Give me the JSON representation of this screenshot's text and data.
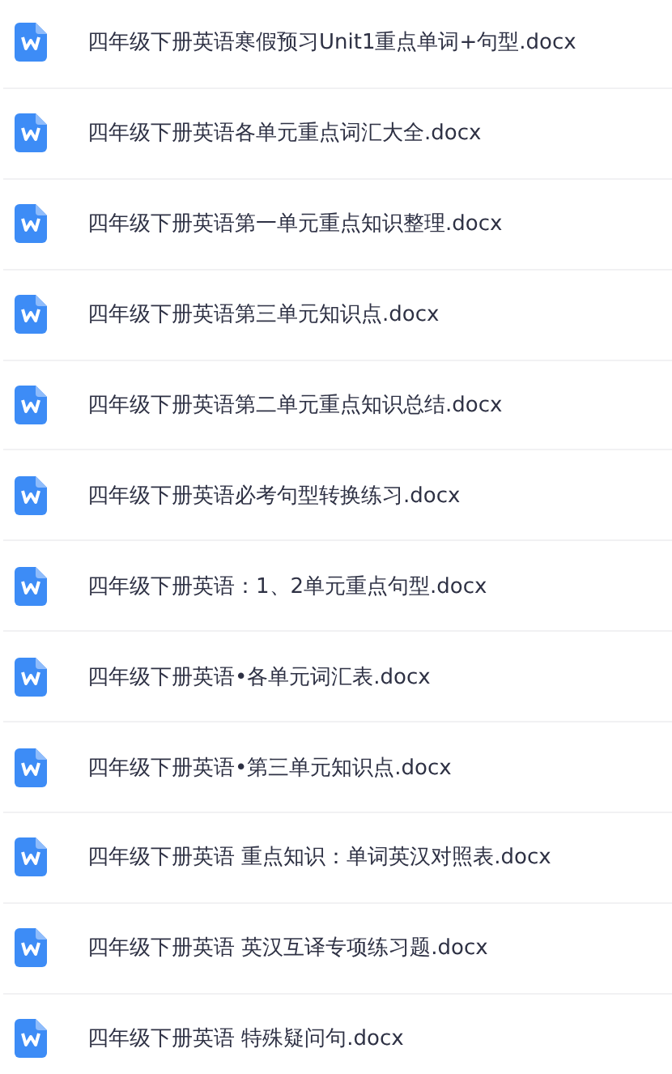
{
  "files": [
    {
      "name": "四年级下册英语寒假预习Unit1重点单词+句型.docx"
    },
    {
      "name": "四年级下册英语各单元重点词汇大全.docx"
    },
    {
      "name": "四年级下册英语第一单元重点知识整理.docx"
    },
    {
      "name": "四年级下册英语第三单元知识点.docx"
    },
    {
      "name": "四年级下册英语第二单元重点知识总结.docx"
    },
    {
      "name": "四年级下册英语必考句型转换练习.docx"
    },
    {
      "name": "四年级下册英语：1、2单元重点句型.docx"
    },
    {
      "name": "四年级下册英语•各单元词汇表.docx"
    },
    {
      "name": "四年级下册英语•第三单元知识点.docx"
    },
    {
      "name": "四年级下册英语 重点知识：单词英汉对照表.docx"
    },
    {
      "name": "四年级下册英语 英汉互译专项练习题.docx"
    },
    {
      "name": "四年级下册英语 特殊疑问句.docx"
    }
  ]
}
